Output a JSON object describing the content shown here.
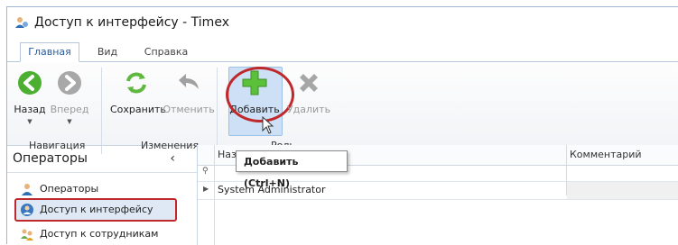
{
  "window": {
    "title": "Доступ к интерфейсу - Timex"
  },
  "tabs": [
    {
      "label": "Главная",
      "active": true
    },
    {
      "label": "Вид",
      "active": false
    },
    {
      "label": "Справка",
      "active": false
    }
  ],
  "ribbon": {
    "buttons": {
      "back": "Назад",
      "forward": "Вперед",
      "save": "Сохранить",
      "undo": "Отменить",
      "add": "Добавить",
      "delete": "Удалить"
    },
    "groups": {
      "navigation": "Навигация",
      "changes": "Изменения",
      "role": "Роль"
    }
  },
  "tooltip": {
    "text": "Добавить (Ctrl+N)"
  },
  "left_panel": {
    "title": "Операторы",
    "items": [
      {
        "label": "Операторы",
        "icon": "user-icon"
      },
      {
        "label": "Доступ к интерфейсу",
        "icon": "globe-user-icon",
        "selected": true
      },
      {
        "label": "Доступ к сотрудникам",
        "icon": "users-icon"
      }
    ]
  },
  "grid": {
    "columns": [
      "Назв",
      "Комментарий"
    ],
    "rows": [
      {
        "name": "System Administrator",
        "comment": ""
      }
    ]
  },
  "colors": {
    "accent": "#2b5c9e",
    "highlight": "#c0292b",
    "green": "#4caf32"
  }
}
